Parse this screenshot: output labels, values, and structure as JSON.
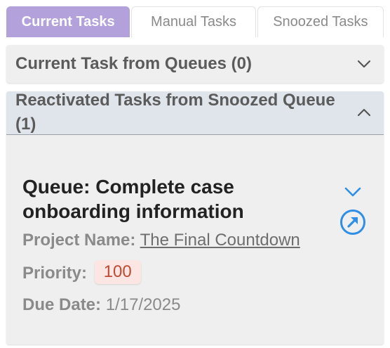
{
  "tabs": [
    {
      "label": "Current Tasks",
      "active": true
    },
    {
      "label": "Manual Tasks",
      "active": false
    },
    {
      "label": "Snoozed Tasks",
      "active": false
    }
  ],
  "sections": {
    "queues": {
      "title": "Current Task from Queues (0)",
      "expanded": false,
      "icon": "chevron-down-icon"
    },
    "reactivated": {
      "title": "Reactivated Tasks from Snoozed Queue (1)",
      "expanded": true,
      "icon": "chevron-up-icon"
    }
  },
  "task": {
    "title": "Queue: Complete case onboarding information",
    "project_label": "Project Name:",
    "project_name": "The Final Countdown",
    "priority_label": "Priority:",
    "priority_value": "100",
    "due_label": "Due Date:",
    "due_value": "1/17/2025",
    "expand_icon": "chevron-down-icon",
    "open_icon": "open-external-icon"
  },
  "colors": {
    "active_tab": "#b3a1dc",
    "panel_bg": "#efefef",
    "expanded_header_bg": "#e0e5ec",
    "accent_icon": "#2f8fe4",
    "priority_badge_bg": "#fbe6e3",
    "priority_badge_text": "#c04a32"
  }
}
